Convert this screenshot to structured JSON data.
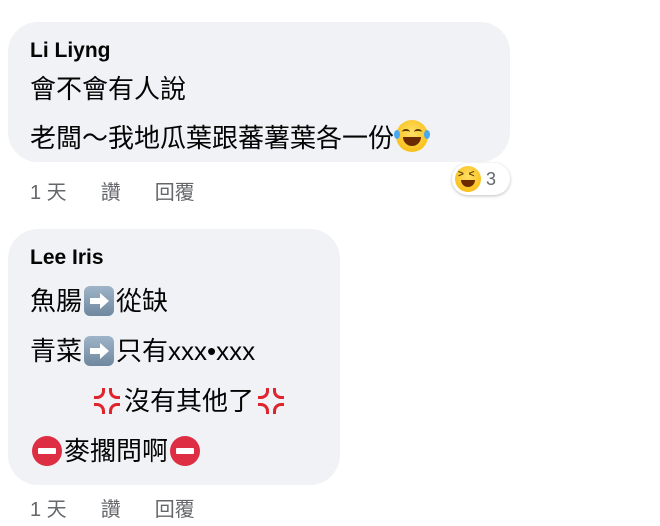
{
  "comments": [
    {
      "author": "Li Liyng",
      "lines": [
        "會不會有人說",
        "老闆～我地瓜葉跟蕃薯葉各一份"
      ],
      "reaction_count": "3",
      "time": "1 天",
      "like_label": "讚",
      "reply_label": "回覆",
      "emoji": [
        "face-with-tears-of-joy",
        "grinning-squinting-face"
      ]
    },
    {
      "author": "Lee Iris",
      "line1_a": "魚腸",
      "line1_b": "從缺",
      "line2_a": "青菜",
      "line2_b": "只有xxx•xxx",
      "line3": "沒有其他了",
      "line4": "麥擱問啊",
      "time": "1 天",
      "like_label": "讚",
      "reply_label": "回覆",
      "emoji": [
        "right-arrow",
        "anger-symbol",
        "no-entry"
      ]
    }
  ]
}
